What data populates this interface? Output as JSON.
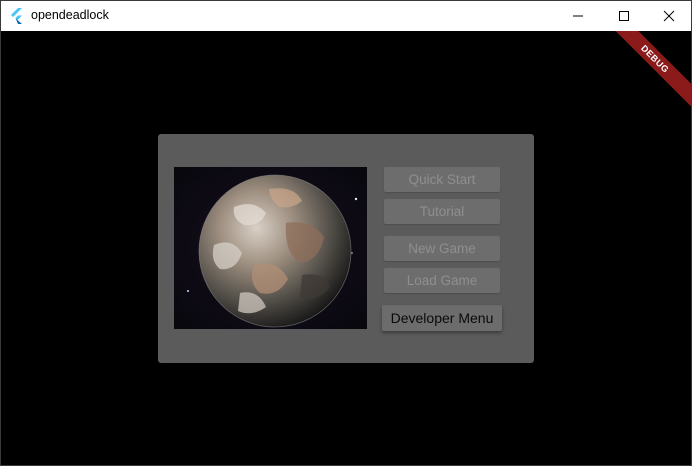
{
  "window": {
    "title": "opendeadlock"
  },
  "debug_banner": {
    "text": "DEBUG"
  },
  "menu": {
    "buttons": [
      {
        "label": "Quick Start",
        "enabled": false
      },
      {
        "label": "Tutorial",
        "enabled": false
      },
      {
        "label": "New Game",
        "enabled": false
      },
      {
        "label": "Load Game",
        "enabled": false
      },
      {
        "label": "Developer Menu",
        "enabled": true
      }
    ]
  },
  "icons": {
    "app": "flutter-logo-icon",
    "minimize": "minimize-icon",
    "maximize": "maximize-icon",
    "close": "close-icon"
  },
  "colors": {
    "panel": "#5b5b5b",
    "background": "#000000",
    "debug_banner": "#8b1a1a",
    "disabled_text": "#8f8f8f"
  }
}
